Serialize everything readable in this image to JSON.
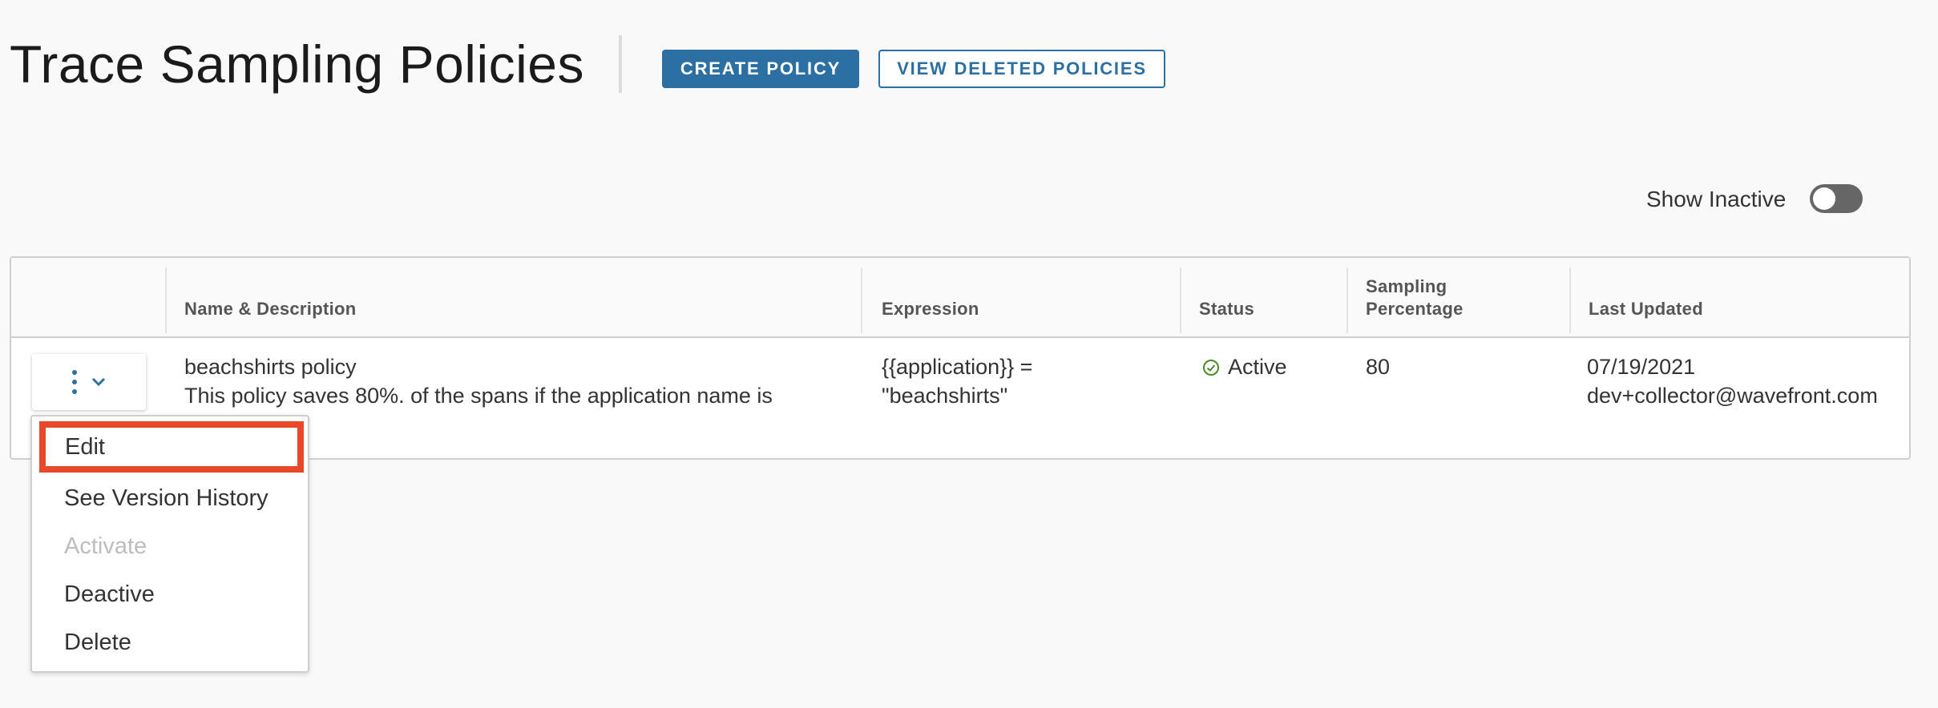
{
  "header": {
    "title": "Trace Sampling Policies",
    "create_label": "CREATE POLICY",
    "view_deleted_label": "VIEW DELETED POLICIES"
  },
  "toggle": {
    "label": "Show Inactive",
    "on": false
  },
  "table": {
    "columns": [
      "Name & Description",
      "Expression",
      "Status",
      "Sampling Percentage",
      "Last Updated"
    ],
    "columns_display": {
      "name": "Name & Description",
      "expression": "Expression",
      "status": "Status",
      "sampling_line1": "Sampling",
      "sampling_line2": "Percentage",
      "last_updated": "Last Updated"
    },
    "rows": [
      {
        "name": "beachshirts policy",
        "description": "This policy saves 80%. of the spans if the application name is",
        "expression_line1": "{{application}} =",
        "expression_line2": "\"beachshirts\"",
        "status": "Active",
        "sampling_percentage": "80",
        "last_updated_date": "07/19/2021",
        "last_updated_by": "dev+collector@wavefront.com"
      }
    ]
  },
  "row_menu": {
    "items": [
      "Edit",
      "See Version History",
      "Activate",
      "Deactive",
      "Delete"
    ],
    "disabled": [
      "Activate"
    ],
    "highlighted": "Edit"
  },
  "colors": {
    "primary": "#2b6fa3",
    "highlight": "#e8472a",
    "status_active": "#4a8a2a",
    "toggle_off": "#666666"
  },
  "icons": {
    "status": "check-circle-icon",
    "row_action": "kebab-icon",
    "dropdown": "chevron-down-icon"
  }
}
